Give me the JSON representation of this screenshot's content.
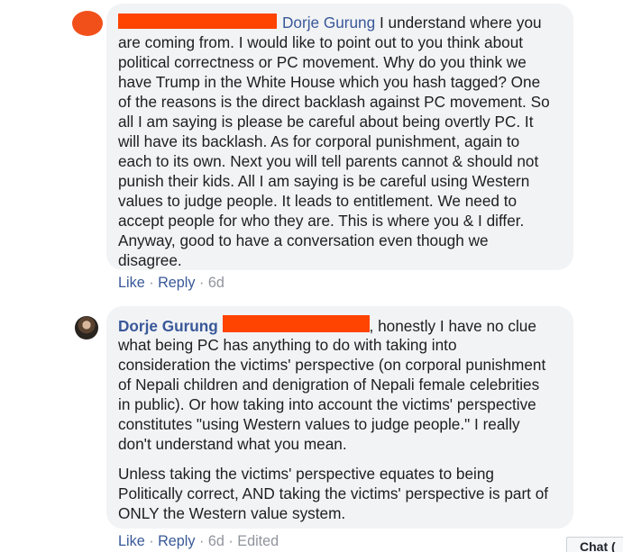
{
  "comments": [
    {
      "mention": "Dorje Gurung",
      "lines": [
        "I understand where you",
        "are coming from. I would like to point out to you think about",
        "political correctness or PC movement. Why do you think we",
        "have Trump in the White House which you hash tagged? One",
        "of the reasons is the direct backlash against PC movement. So",
        "all I am saying is please be careful about being overtly PC. It",
        "will have its backlash. As for corporal punishment, again to",
        "each to its own. Next you will tell parents cannot & should not",
        "punish their kids. All I am saying is be careful using Western",
        "values to judge people. It leads to entitlement. We need to",
        "accept people for who they are. This is where you & I differ.",
        "Anyway, good to have a conversation even though we",
        "disagree."
      ],
      "actions": {
        "like": "Like",
        "reply": "Reply",
        "time": "6d"
      }
    },
    {
      "author": "Dorje Gurung",
      "first_line_suffix": ", honestly I have no clue",
      "paragraph_1": [
        "what being PC has anything to do with taking into",
        "consideration the victims' perspective (on corporal punishment",
        "of Nepali children and denigration of Nepali female celebrities",
        "in public). Or how taking into account the victims' perspective",
        "constitutes \"using Western values to judge people.\" I really",
        "don't understand what you mean."
      ],
      "paragraph_2": [
        "Unless taking the victims' perspective equates to being",
        "Politically correct, AND taking the victims' perspective is part of",
        "ONLY the Western value system."
      ],
      "actions": {
        "like": "Like",
        "reply": "Reply",
        "time": "6d",
        "edited": "Edited"
      }
    }
  ],
  "separator": "·",
  "chat_label": "Chat (",
  "colors": {
    "link": "#385898",
    "bubble": "#f2f3f5",
    "redaction": "#ff4300",
    "meta": "#90949c"
  },
  "icons": {
    "avatar_1": "redacted-avatar",
    "avatar_2": "profile-photo-avatar"
  }
}
